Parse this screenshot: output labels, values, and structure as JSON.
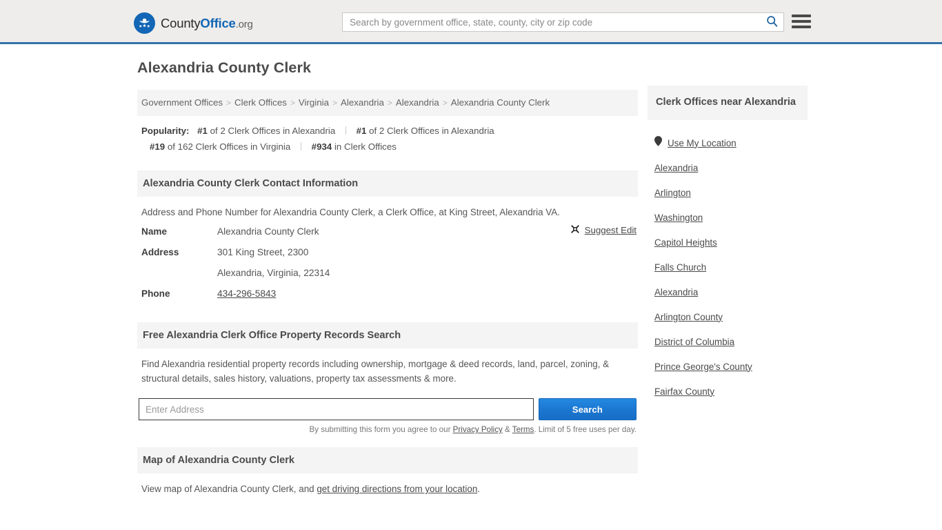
{
  "header": {
    "logo": {
      "icon": "eagle-seal-logo-icon",
      "text_county": "County",
      "text_office": "Office",
      "text_org": ".org"
    },
    "search": {
      "placeholder": "Search by government office, state, county, city or zip code",
      "value": "",
      "icon": "search-icon"
    },
    "menu_icon": "hamburger-menu-icon"
  },
  "main": {
    "title": "Alexandria County Clerk",
    "breadcrumb": {
      "separator": ">",
      "items": [
        "Government Offices",
        "Clerk Offices",
        "Virginia",
        "Alexandria",
        "Alexandria",
        "Alexandria County Clerk"
      ]
    },
    "popularity": {
      "label": "Popularity:",
      "items": [
        {
          "rank": "#1",
          "text": "of 2 Clerk Offices in Alexandria"
        },
        {
          "rank": "#1",
          "text": "of 2 Clerk Offices in Alexandria"
        },
        {
          "rank": "#19",
          "text": "of 162 Clerk Offices in Virginia"
        },
        {
          "rank": "#934",
          "text": "in Clerk Offices"
        }
      ]
    },
    "contact_section": {
      "heading": "Alexandria County Clerk Contact Information",
      "description": "Address and Phone Number for Alexandria County Clerk, a Clerk Office, at King Street, Alexandria VA.",
      "rows": [
        {
          "key": "Name",
          "value": "Alexandria County Clerk"
        },
        {
          "key": "Address",
          "value": "301 King Street, 2300"
        },
        {
          "key": "",
          "value": "Alexandria, Virginia, 22314"
        },
        {
          "key": "Phone",
          "value": "434-296-5843"
        }
      ],
      "suggest_edit": {
        "label": "Suggest Edit",
        "icon": "suggest-edit-icon"
      }
    },
    "property_section": {
      "heading": "Free Alexandria Clerk Office Property Records Search",
      "description": "Find Alexandria residential property records including ownership, mortgage & deed records, land, parcel, zoning, & structural details, sales history, valuations, property tax assessments & more.",
      "input_placeholder": "Enter Address",
      "input_value": "",
      "button_label": "Search",
      "note_prefix": "By submitting this form you agree to our ",
      "note_privacy": "Privacy Policy",
      "note_amp": " & ",
      "note_terms": "Terms",
      "note_suffix": ". Limit of 5 free uses per day."
    },
    "map_section": {
      "heading": "Map of Alexandria County Clerk",
      "text_prefix": "View map of Alexandria County Clerk, and ",
      "link": "get driving directions from your location",
      "text_suffix": "."
    }
  },
  "sidebar": {
    "heading": "Clerk Offices near Alexandria",
    "use_my_location": {
      "label": "Use My Location",
      "icon": "map-pin-icon"
    },
    "links": [
      "Alexandria",
      "Arlington",
      "Washington",
      "Capitol Heights",
      "Falls Church",
      "Alexandria",
      "Arlington County",
      "District of Columbia",
      "Prince George's County",
      "Fairfax County"
    ]
  },
  "colors": {
    "brand_blue": "#1266b5",
    "header_border": "#3272a8",
    "header_bg": "#eeedeb",
    "panel_bg": "#f4f4f4",
    "button_blue": "#1b76d0"
  }
}
